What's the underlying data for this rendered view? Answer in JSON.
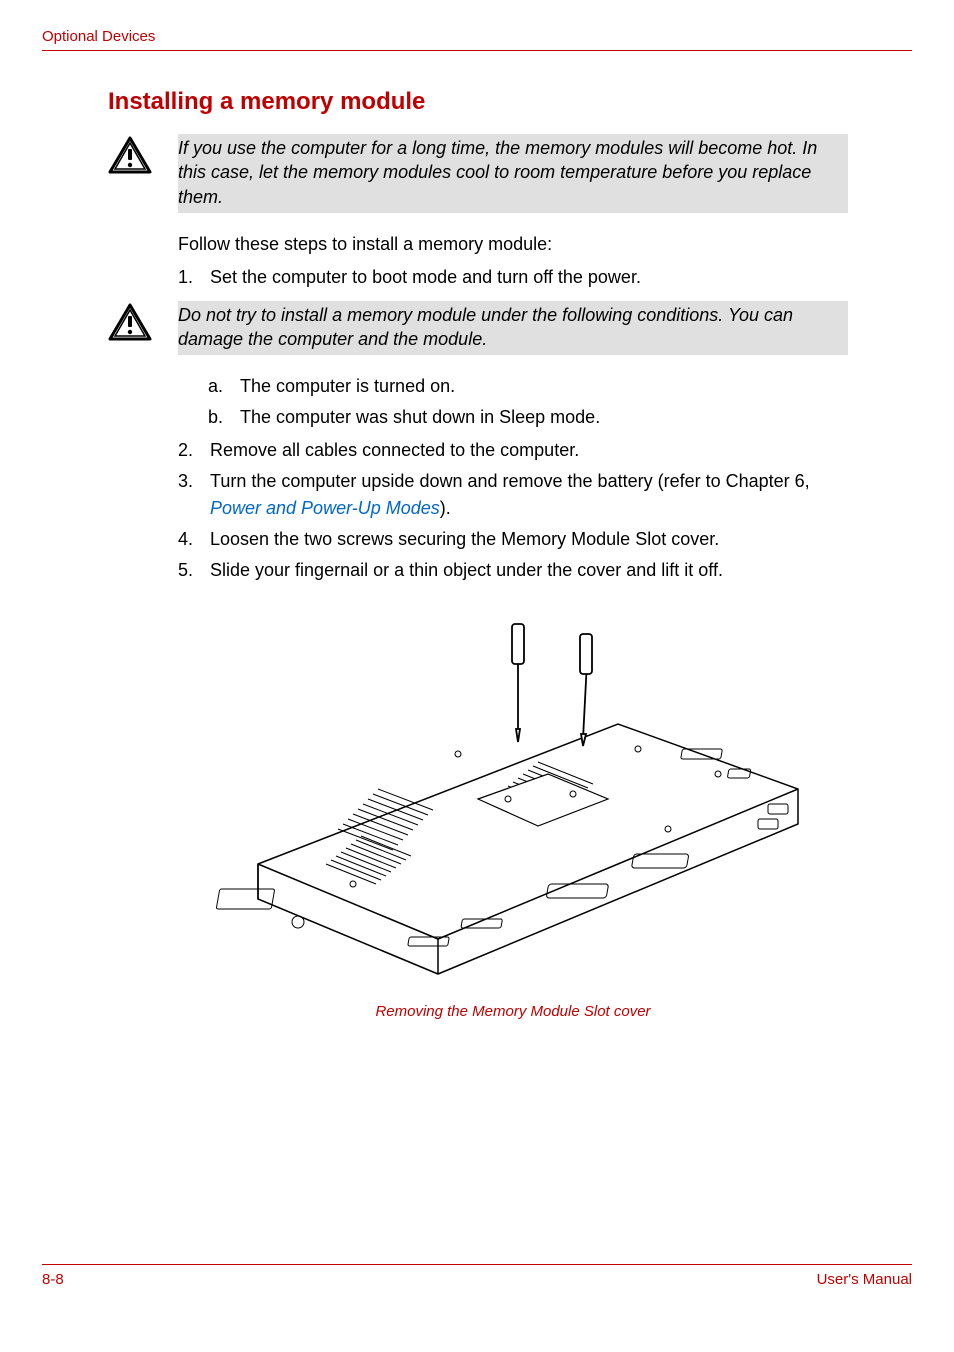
{
  "header": {
    "title": "Optional Devices"
  },
  "section": {
    "heading": "Installing a memory module"
  },
  "caution1": {
    "text": "If you use the computer for a long time, the memory modules will become hot. In this case, let the memory modules cool to room temperature before you replace them."
  },
  "intro": {
    "text": "Follow these steps to install a memory module:"
  },
  "step1": {
    "num": "1.",
    "text": "Set the computer to boot mode and turn off the power."
  },
  "caution2": {
    "text": "Do not try to install a memory module under the following conditions. You can damage the computer and the module."
  },
  "sub_a": {
    "label": "a.",
    "text": "The computer is turned on."
  },
  "sub_b": {
    "label": "b.",
    "text": "The computer was shut down in Sleep mode."
  },
  "step2": {
    "num": "2.",
    "text": "Remove all cables connected to the computer."
  },
  "step3": {
    "num": "3.",
    "text_before": "Turn the computer upside down and remove the battery (refer to Chapter 6, ",
    "link": "Power and Power-Up Modes",
    "text_after": ")."
  },
  "step4": {
    "num": "4.",
    "text": "Loosen the two screws securing the Memory Module Slot cover."
  },
  "step5": {
    "num": "5.",
    "text": "Slide your fingernail or a thin object under the cover and lift it off."
  },
  "figure": {
    "caption": "Removing the Memory Module Slot cover"
  },
  "footer": {
    "page": "8-8",
    "doc": "User's Manual"
  }
}
